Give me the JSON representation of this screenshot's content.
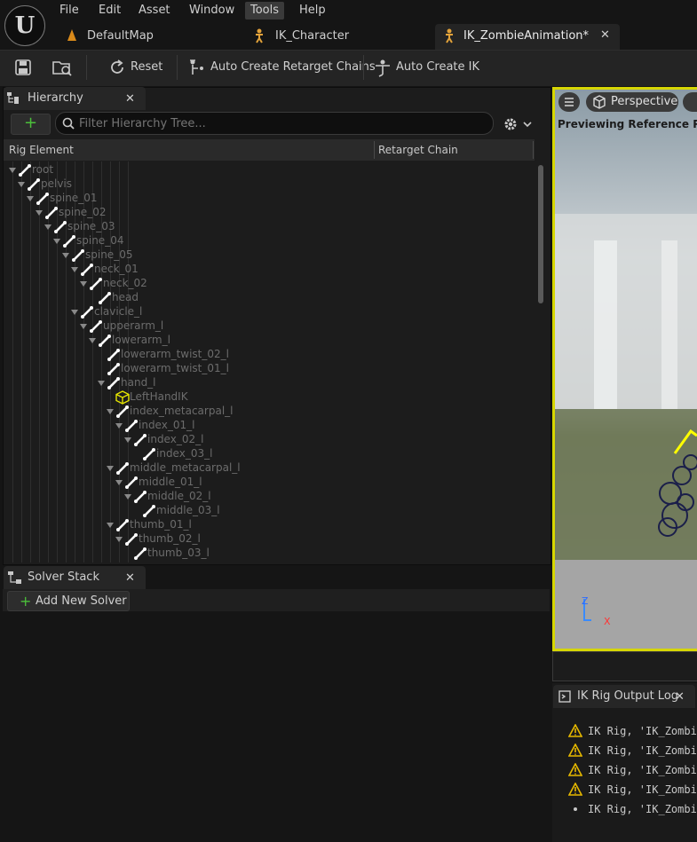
{
  "menu": [
    "File",
    "Edit",
    "Asset",
    "Window",
    "Tools",
    "Help"
  ],
  "doc_tabs": [
    "DefaultMap",
    "IK_Character",
    "IK_ZombieAnimation*"
  ],
  "toolbar": {
    "reset_label": "Reset",
    "auto_chains_label": "Auto Create Retarget Chains",
    "auto_ik_label": "Auto Create IK"
  },
  "hierarchy": {
    "tab_label": "Hierarchy",
    "search_placeholder": "Filter Hierarchy Tree...",
    "col_element": "Rig Element",
    "col_chain": "Retarget Chain",
    "items": [
      {
        "label": "root",
        "depth": 0,
        "type": "bone",
        "arrow": true
      },
      {
        "label": "pelvis",
        "depth": 1,
        "type": "bone",
        "arrow": true
      },
      {
        "label": "spine_01",
        "depth": 2,
        "type": "bone",
        "arrow": true
      },
      {
        "label": "spine_02",
        "depth": 3,
        "type": "bone",
        "arrow": true
      },
      {
        "label": "spine_03",
        "depth": 4,
        "type": "bone",
        "arrow": true
      },
      {
        "label": "spine_04",
        "depth": 5,
        "type": "bone",
        "arrow": true
      },
      {
        "label": "spine_05",
        "depth": 6,
        "type": "bone",
        "arrow": true
      },
      {
        "label": "neck_01",
        "depth": 7,
        "type": "bone",
        "arrow": true
      },
      {
        "label": "neck_02",
        "depth": 8,
        "type": "bone",
        "arrow": true
      },
      {
        "label": "head",
        "depth": 9,
        "type": "bone",
        "arrow": false
      },
      {
        "label": "clavicle_l",
        "depth": 7,
        "type": "bone",
        "arrow": true
      },
      {
        "label": "upperarm_l",
        "depth": 8,
        "type": "bone",
        "arrow": true
      },
      {
        "label": "lowerarm_l",
        "depth": 9,
        "type": "bone",
        "arrow": true
      },
      {
        "label": "lowerarm_twist_02_l",
        "depth": 10,
        "type": "bone",
        "arrow": false
      },
      {
        "label": "lowerarm_twist_01_l",
        "depth": 10,
        "type": "bone",
        "arrow": false
      },
      {
        "label": "hand_l",
        "depth": 10,
        "type": "bone",
        "arrow": true
      },
      {
        "label": "LeftHandIK",
        "depth": 11,
        "type": "goal",
        "arrow": false
      },
      {
        "label": "index_metacarpal_l",
        "depth": 11,
        "type": "bone",
        "arrow": true
      },
      {
        "label": "index_01_l",
        "depth": 12,
        "type": "bone",
        "arrow": true
      },
      {
        "label": "index_02_l",
        "depth": 13,
        "type": "bone",
        "arrow": true
      },
      {
        "label": "index_03_l",
        "depth": 14,
        "type": "bone",
        "arrow": false
      },
      {
        "label": "middle_metacarpal_l",
        "depth": 11,
        "type": "bone",
        "arrow": true
      },
      {
        "label": "middle_01_l",
        "depth": 12,
        "type": "bone",
        "arrow": true
      },
      {
        "label": "middle_02_l",
        "depth": 13,
        "type": "bone",
        "arrow": true
      },
      {
        "label": "middle_03_l",
        "depth": 14,
        "type": "bone",
        "arrow": false
      },
      {
        "label": "thumb_01_l",
        "depth": 11,
        "type": "bone",
        "arrow": true
      },
      {
        "label": "thumb_02_l",
        "depth": 12,
        "type": "bone",
        "arrow": true
      },
      {
        "label": "thumb_03_l",
        "depth": 13,
        "type": "bone",
        "arrow": false
      }
    ]
  },
  "solver": {
    "tab_label": "Solver Stack",
    "add_label": "Add New Solver"
  },
  "viewport": {
    "perspective_label": "Perspective",
    "overlay_text": "Previewing Reference Pose",
    "axis_z": "Z",
    "axis_x": "X"
  },
  "log": {
    "tab_label": "IK Rig Output Log",
    "lines": [
      {
        "kind": "warning",
        "text": "IK Rig, 'IK_Zombie"
      },
      {
        "kind": "warning",
        "text": "IK Rig, 'IK_Zombie"
      },
      {
        "kind": "warning",
        "text": "IK Rig, 'IK_Zombie"
      },
      {
        "kind": "warning",
        "text": "IK Rig, 'IK_Zombie"
      },
      {
        "kind": "info",
        "text": "IK Rig, 'IK_Zombie"
      }
    ]
  },
  "colors": {
    "accent_green": "#4bbf3a",
    "warning": "#e6b800",
    "viewport_border": "#d6d600"
  }
}
